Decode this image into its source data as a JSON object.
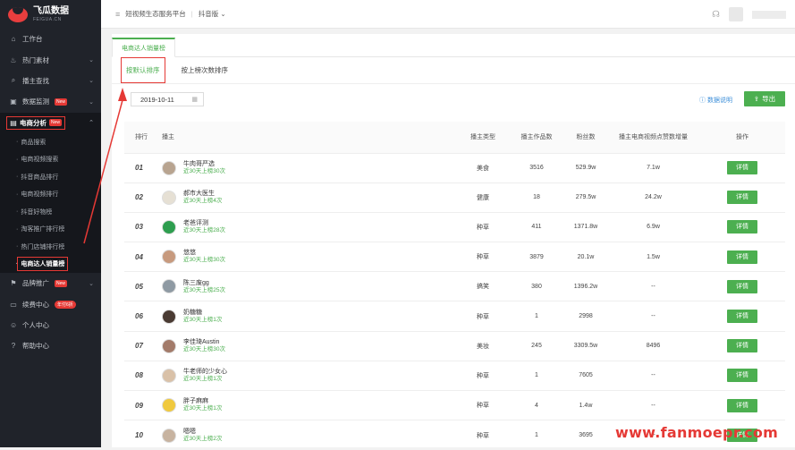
{
  "logo": {
    "title": "飞瓜数据",
    "subtitle": "FEIGUA.CN"
  },
  "sidebar": {
    "items": [
      {
        "label": "工作台",
        "icon": "home-icon"
      },
      {
        "label": "热门素材",
        "icon": "fire-icon",
        "chevron": "⌄"
      },
      {
        "label": "播主查找",
        "icon": "search-icon",
        "chevron": "⌄"
      },
      {
        "label": "数据监测",
        "icon": "monitor-icon",
        "badge": "New",
        "chevron": "⌄"
      },
      {
        "label": "电商分析",
        "icon": "shop-icon",
        "badge": "New",
        "chevron": "⌃",
        "active": true
      }
    ],
    "subitems": [
      "商品搜索",
      "电商视频搜索",
      "抖音商品排行",
      "电商视频排行",
      "抖音好物榜",
      "淘客推广排行榜",
      "热门店铺排行榜",
      "电商达人销量榜"
    ],
    "bottom": [
      {
        "label": "品牌推广",
        "icon": "flag-icon",
        "badge": "New",
        "chevron": "⌄"
      },
      {
        "label": "续费中心",
        "icon": "wallet-icon",
        "badge": "年付6折"
      },
      {
        "label": "个人中心",
        "icon": "user-icon"
      },
      {
        "label": "帮助中心",
        "icon": "help-icon"
      }
    ]
  },
  "topbar": {
    "platform": "短视频生态服务平台",
    "version": "抖音版",
    "version_chevron": "⌄"
  },
  "tabs": {
    "main": "电商达人销量榜",
    "sub": [
      "按默认排序",
      "按上榜次数排序"
    ]
  },
  "filters": {
    "date": "2019-10-11",
    "doc_link": "数据说明",
    "export": "导出"
  },
  "table": {
    "headers": {
      "rank": "排行",
      "anchor": "播主",
      "type": "播主类型",
      "works": "播主作品数",
      "fans": "粉丝数",
      "sales": "播主电商视频点赞数增量",
      "action": "操作"
    },
    "rows": [
      {
        "rank": "01",
        "name": "牛肉哥严选",
        "sub": "近30天上榜30次",
        "type": "美食",
        "works": "3516",
        "fans": "529.9w",
        "sales": "7.1w",
        "action": "详情",
        "avatar": "#b8a490"
      },
      {
        "rank": "02",
        "name": "郝市大医生",
        "sub": "近30天上榜4次",
        "type": "健康",
        "works": "18",
        "fans": "279.5w",
        "sales": "24.2w",
        "action": "详情",
        "avatar": "#e6e0d4"
      },
      {
        "rank": "03",
        "name": "老爸评测",
        "sub": "近30天上榜28次",
        "type": "种草",
        "works": "411",
        "fans": "1371.8w",
        "sales": "6.9w",
        "action": "详情",
        "avatar": "#2e9e4f"
      },
      {
        "rank": "04",
        "name": "悠悠",
        "sub": "近30天上榜30次",
        "type": "种草",
        "works": "3879",
        "fans": "20.1w",
        "sales": "1.5w",
        "action": "详情",
        "avatar": "#c79a7e"
      },
      {
        "rank": "05",
        "name": "陈三废gg",
        "sub": "近30天上榜25次",
        "type": "搞笑",
        "works": "380",
        "fans": "1396.2w",
        "sales": "--",
        "action": "详情",
        "avatar": "#8f9aa3"
      },
      {
        "rank": "06",
        "name": "奶糖糖",
        "sub": "近30天上榜1次",
        "type": "种草",
        "works": "1",
        "fans": "2998",
        "sales": "--",
        "action": "详情",
        "avatar": "#4a3b33"
      },
      {
        "rank": "07",
        "name": "李佳琦Austin",
        "sub": "近30天上榜30次",
        "type": "美妆",
        "works": "245",
        "fans": "3309.5w",
        "sales": "8496",
        "action": "详情",
        "avatar": "#a37b6a"
      },
      {
        "rank": "08",
        "name": "牛老师的少女心",
        "sub": "近30天上榜1次",
        "type": "种草",
        "works": "1",
        "fans": "7605",
        "sales": "--",
        "action": "详情",
        "avatar": "#d9c1a8"
      },
      {
        "rank": "09",
        "name": "胖子麻麻",
        "sub": "近30天上榜1次",
        "type": "种草",
        "works": "4",
        "fans": "1.4w",
        "sales": "--",
        "action": "详情",
        "avatar": "#f0c93e"
      },
      {
        "rank": "10",
        "name": "嗯嗯",
        "sub": "近30天上榜2次",
        "type": "种草",
        "works": "1",
        "fans": "3695",
        "sales": "--",
        "action": "详情",
        "avatar": "#c7b3a0"
      }
    ]
  },
  "watermark": "www.fanmoepr.com",
  "colors": {
    "accent": "#4caf50",
    "highlight": "#e53935",
    "sidebar": "#20232a"
  }
}
